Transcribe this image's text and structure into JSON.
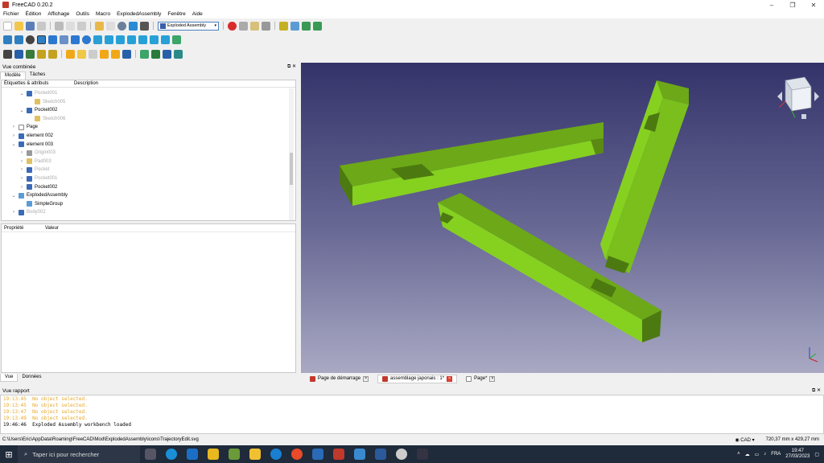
{
  "window": {
    "title": "FreeCAD 0.20.2",
    "controls": [
      "–",
      "❐",
      "✕"
    ]
  },
  "menu": [
    "Fichier",
    "Édition",
    "Affichage",
    "Outils",
    "Macro",
    "ExplodedAssembly",
    "Fenêtre",
    "Aide"
  ],
  "workbench": {
    "selected": "Exploded Assembly"
  },
  "combo_view": {
    "title": "Vue combinée",
    "tabs": [
      "Modèle",
      "Tâches"
    ],
    "tree_headers": [
      "Étiquettes & attributs",
      "Description"
    ],
    "tree_items": [
      {
        "label": "Pocket001",
        "indent": 2,
        "expander": "⌄",
        "dim": true,
        "icon": "pocket-icon"
      },
      {
        "label": "Sketch005",
        "indent": 3,
        "expander": "",
        "dim": true,
        "icon": "sketch-icon"
      },
      {
        "label": "Pocket002",
        "indent": 2,
        "expander": "⌄",
        "dim": false,
        "icon": "pocket-icon"
      },
      {
        "label": "Sketch006",
        "indent": 3,
        "expander": "",
        "dim": true,
        "icon": "sketch-icon"
      },
      {
        "label": "Page",
        "indent": 1,
        "expander": "›",
        "dim": false,
        "icon": "page-icon"
      },
      {
        "label": "element 002",
        "indent": 1,
        "expander": "›",
        "dim": false,
        "icon": "body-icon"
      },
      {
        "label": "element 003",
        "indent": 1,
        "expander": "⌄",
        "dim": false,
        "icon": "body-icon"
      },
      {
        "label": "Origin003",
        "indent": 2,
        "expander": "›",
        "dim": true,
        "icon": "origin-icon"
      },
      {
        "label": "Pad003",
        "indent": 2,
        "expander": "›",
        "dim": true,
        "icon": "pad-icon"
      },
      {
        "label": "Pocket",
        "indent": 2,
        "expander": "›",
        "dim": true,
        "icon": "pocket-icon"
      },
      {
        "label": "Pocket001",
        "indent": 2,
        "expander": "›",
        "dim": true,
        "icon": "pocket-icon"
      },
      {
        "label": "Pocket002",
        "indent": 2,
        "expander": "›",
        "dim": false,
        "icon": "pocket-icon"
      },
      {
        "label": "ExplodedAssembly",
        "indent": 1,
        "expander": "⌄",
        "dim": false,
        "icon": "folder-icon"
      },
      {
        "label": "SimpleGroup",
        "indent": 2,
        "expander": "",
        "dim": false,
        "icon": "folder-icon"
      },
      {
        "label": "Body002",
        "indent": 1,
        "expander": "›",
        "dim": true,
        "icon": "body-icon"
      }
    ],
    "prop_headers": [
      "Propriété",
      "Valeur"
    ],
    "bottom_tabs": [
      "Vue",
      "Données"
    ]
  },
  "doc_tabs": [
    {
      "label": "Page de démarrage",
      "active": false
    },
    {
      "label": "assemblage japonais : 1*",
      "active": true
    },
    {
      "label": "Page*",
      "active": false
    }
  ],
  "report": {
    "title": "Vue rapport",
    "lines": [
      {
        "text": "19:13:45  No object selected.",
        "warn": true
      },
      {
        "text": "19:13:45  No object selected.",
        "warn": true
      },
      {
        "text": "19:13:47  No object selected.",
        "warn": true
      },
      {
        "text": "19:13:49  No object selected.",
        "warn": true
      },
      {
        "text": "19:46:46  Exploded Assembly workbench loaded",
        "warn": false
      }
    ]
  },
  "status": {
    "path": "C:\\Users\\Eric\\AppData\\Roaming\\FreeCAD\\Mod\\ExplodedAssembly\\icons\\TrajectoryEdit.svg",
    "nav_style": "CAD",
    "dimensions": "720,37 mm x 429,27 mm"
  },
  "taskbar": {
    "search_placeholder": "Taper ici pour rechercher",
    "lang": "FRA",
    "time": "19:47",
    "date": "27/03/2023"
  },
  "colors": {
    "part": "#86d120",
    "part_dark": "#4c7a10",
    "viewport_top": "#33336a",
    "viewport_bottom": "#a9a9c4"
  }
}
